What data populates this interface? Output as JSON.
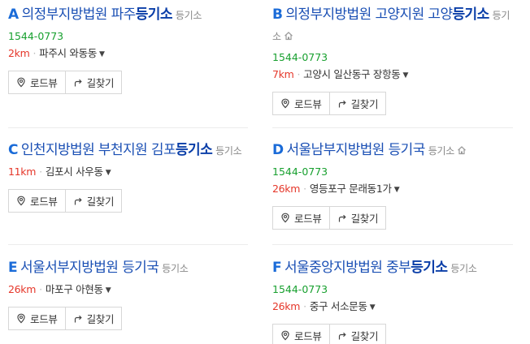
{
  "results": [
    {
      "marker": "A",
      "name_pre": "의정부지방법원 파주",
      "name_bold": "등기소",
      "category": "등기소",
      "has_home_icon": false,
      "phone": "1544-0773",
      "distance": "2km",
      "address": "파주시 와동동",
      "btn_roadview": "로드뷰",
      "btn_route": "길찾기"
    },
    {
      "marker": "B",
      "name_pre": "의정부지방법원 고양지원 고양",
      "name_bold": "등기소",
      "category": "등기소",
      "has_home_icon": true,
      "phone": "1544-0773",
      "distance": "7km",
      "address": "고양시 일산동구 장항동",
      "btn_roadview": "로드뷰",
      "btn_route": "길찾기"
    },
    {
      "marker": "C",
      "name_pre": "인천지방법원 부천지원 김포",
      "name_bold": "등기소",
      "category": "등기소",
      "has_home_icon": false,
      "phone": "",
      "distance": "11km",
      "address": "김포시 사우동",
      "btn_roadview": "로드뷰",
      "btn_route": "길찾기"
    },
    {
      "marker": "D",
      "name_pre": "서울남부지방법원 등기국",
      "name_bold": "",
      "category": "등기소",
      "has_home_icon": true,
      "phone": "1544-0773",
      "distance": "26km",
      "address": "영등포구 문래동1가",
      "btn_roadview": "로드뷰",
      "btn_route": "길찾기"
    },
    {
      "marker": "E",
      "name_pre": "서울서부지방법원 등기국",
      "name_bold": "",
      "category": "등기소",
      "has_home_icon": false,
      "phone": "",
      "distance": "26km",
      "address": "마포구 아현동",
      "btn_roadview": "로드뷰",
      "btn_route": "길찾기"
    },
    {
      "marker": "F",
      "name_pre": "서울중앙지방법원 중부",
      "name_bold": "등기소",
      "category": "등기소",
      "has_home_icon": false,
      "phone": "1544-0773",
      "distance": "26km",
      "address": "중구 서소문동",
      "btn_roadview": "로드뷰",
      "btn_route": "길찾기"
    }
  ],
  "colors": {
    "title": "#1a4fb4",
    "phone": "#18a02f",
    "distance": "#e5372a"
  },
  "icons": {
    "home": "home-icon",
    "roadview": "pin-icon",
    "route": "route-arrow-icon",
    "dropdown": "caret-down-icon"
  }
}
